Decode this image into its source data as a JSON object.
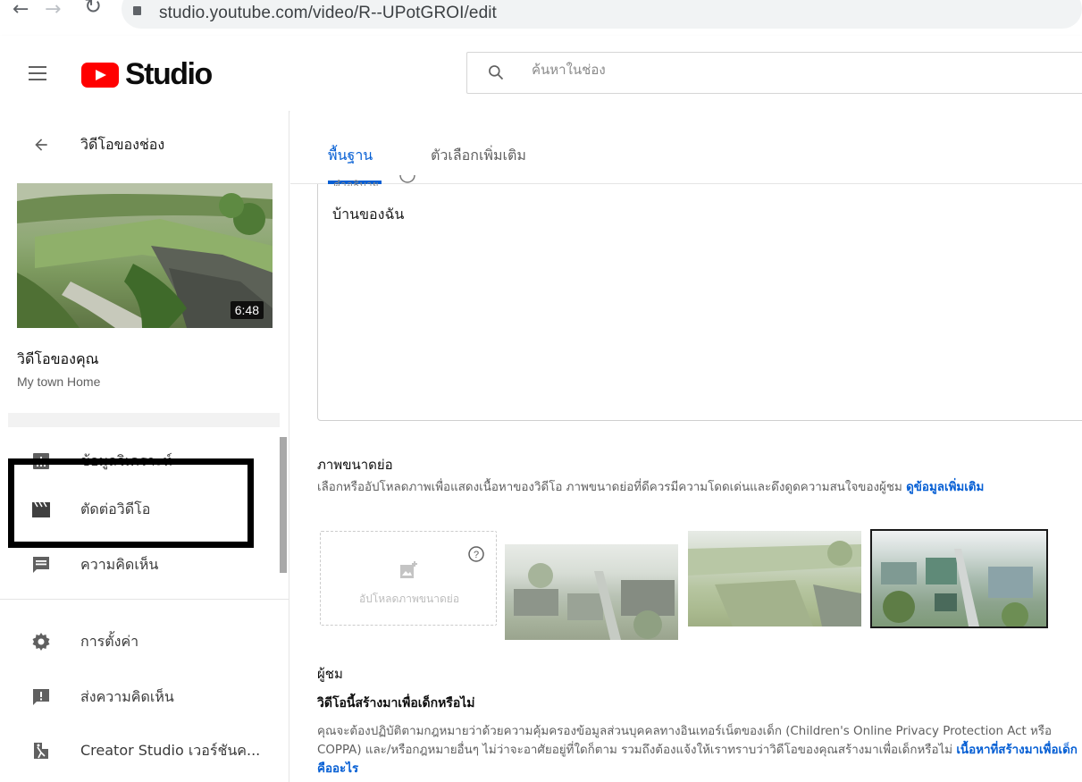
{
  "browser": {
    "url": "studio.youtube.com/video/R--UPotGROI/edit"
  },
  "header": {
    "logo_text": "Studio",
    "search_placeholder": "ค้นหาในช่อง"
  },
  "sidebar": {
    "back_label": "วิดีโอของช่อง",
    "video_duration": "6:48",
    "your_video_label": "วิดีโอของคุณ",
    "video_title": "My town Home",
    "items": [
      {
        "label": "ข้อมูลวิเคราะห์",
        "icon": "analytics-icon"
      },
      {
        "label": "ตัดต่อวิดีโอ",
        "icon": "editor-clapper-icon"
      },
      {
        "label": "ความคิดเห็น",
        "icon": "comments-icon"
      },
      {
        "label": "การตั้งค่า",
        "icon": "gear-icon"
      },
      {
        "label": "ส่งความคิดเห็น",
        "icon": "feedback-icon"
      },
      {
        "label": "Creator Studio เวอร์ชันค...",
        "icon": "classic-studio-icon"
      }
    ]
  },
  "main": {
    "tabs": [
      {
        "label": "พื้นฐาน",
        "active": true
      },
      {
        "label": "ตัวเลือกเพิ่มเติม",
        "active": false
      }
    ],
    "description_label": "คำอธิบาย",
    "description_text": "บ้านของฉัน",
    "thumbnail": {
      "title": "ภาพขนาดย่อ",
      "desc": "เลือกหรืออัปโหลดภาพเพื่อแสดงเนื้อหาของวิดีโอ ภาพขนาดย่อที่ดีควรมีความโดดเด่นและดึงดูดความสนใจของผู้ชม ",
      "learn_more": "ดูข้อมูลเพิ่มเติม",
      "upload_label": "อัปโหลดภาพขนาดย่อ"
    },
    "audience": {
      "title": "ผู้ชม",
      "question": "วิดีโอนี้สร้างมาเพื่อเด็กหรือไม่",
      "desc": "คุณจะต้องปฏิบัติตามกฎหมายว่าด้วยความคุ้มครองข้อมูลส่วนบุคคลทางอินเทอร์เน็ตของเด็ก (Children's Online Privacy Protection Act หรือ COPPA) และ/หรือกฎหมายอื่นๆ ไม่ว่าจะอาศัยอยู่ที่ใดก็ตาม รวมถึงต้องแจ้งให้เราทราบว่าวิดีโอของคุณสร้างมาเพื่อเด็กหรือไม่ ",
      "link": "เนื้อหาที่สร้างมาเพื่อเด็กคืออะไร"
    }
  },
  "colors": {
    "brand_red": "#ff0000",
    "link_blue": "#065fd4",
    "highlight_border": "#000000"
  }
}
